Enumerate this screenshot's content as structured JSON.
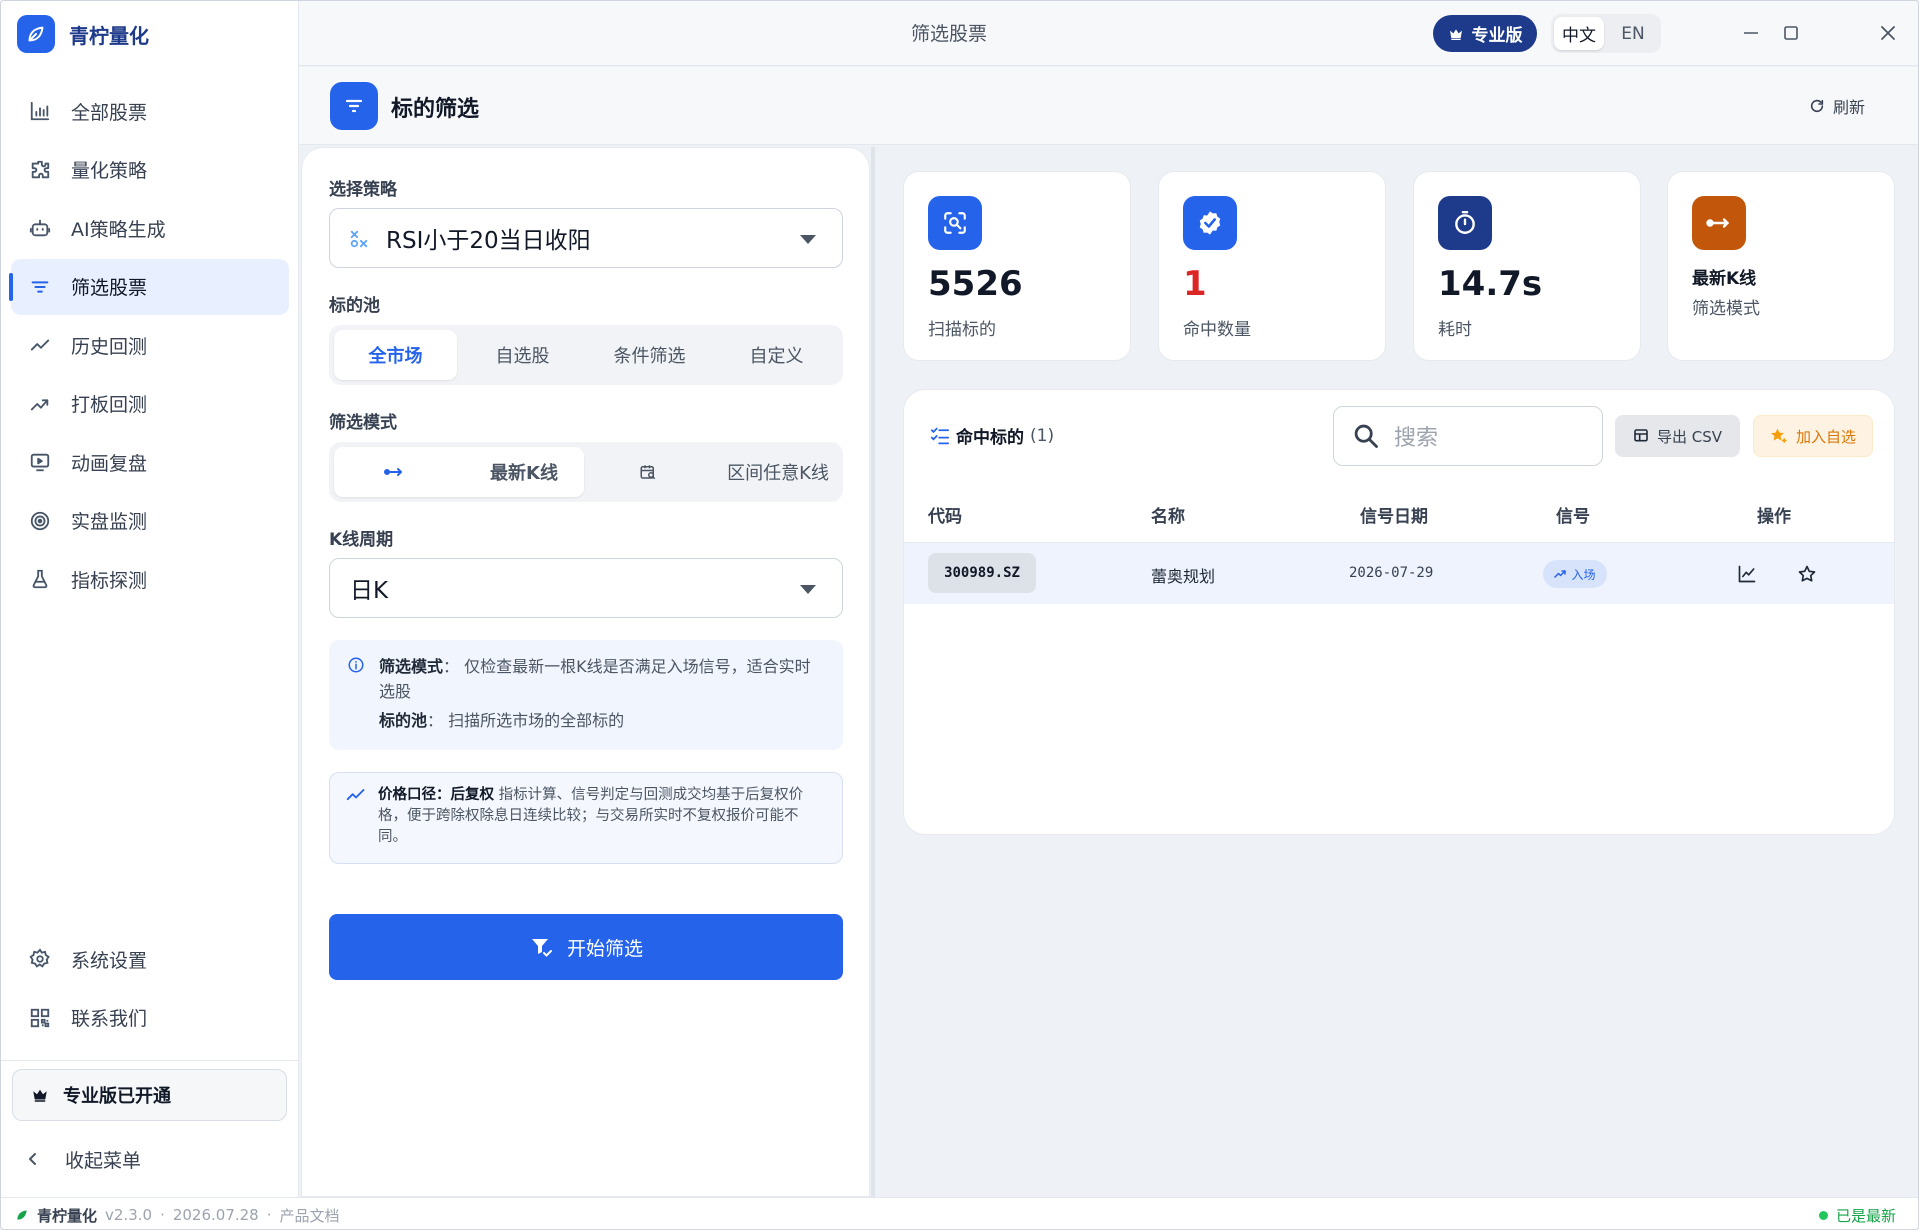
{
  "app": {
    "name": "青柠量化",
    "version": "v2.3.0",
    "build_date": "2026.07.28",
    "docs_link": "产品文档",
    "status": "已是最新"
  },
  "window": {
    "title": "筛选股票"
  },
  "topbar": {
    "pro_label": "专业版",
    "lang_options": [
      "中文",
      "EN"
    ],
    "lang_selected": "中文"
  },
  "sidebar": {
    "items": [
      {
        "label": "全部股票",
        "icon": "bar-chart-icon"
      },
      {
        "label": "量化策略",
        "icon": "puzzle-icon"
      },
      {
        "label": "AI策略生成",
        "icon": "robot-icon"
      },
      {
        "label": "筛选股票",
        "icon": "filter-icon",
        "active": true
      },
      {
        "label": "历史回测",
        "icon": "line-chart-icon"
      },
      {
        "label": "打板回测",
        "icon": "trending-up-icon"
      },
      {
        "label": "动画复盘",
        "icon": "monitor-play-icon"
      },
      {
        "label": "实盘监测",
        "icon": "radar-icon"
      },
      {
        "label": "指标探测",
        "icon": "flask-icon"
      }
    ],
    "bottom": [
      {
        "label": "系统设置",
        "icon": "gear-icon"
      },
      {
        "label": "联系我们",
        "icon": "qr-code-icon"
      }
    ],
    "pro_status": "专业版已开通",
    "collapse_label": "收起菜单"
  },
  "page": {
    "title": "标的筛选",
    "refresh_label": "刷新"
  },
  "form": {
    "strategy_label": "选择策略",
    "strategy_value": "RSI小于20当日收阳",
    "pool_label": "标的池",
    "pool_options": [
      "全市场",
      "自选股",
      "条件筛选",
      "自定义"
    ],
    "pool_selected": "全市场",
    "mode_label": "筛选模式",
    "mode_options": [
      "最新K线",
      "区间任意K线"
    ],
    "mode_selected": "最新K线",
    "period_label": "K线周期",
    "period_value": "日K",
    "info_mode_key": "筛选模式",
    "info_mode_text": "仅检查最新一根K线是否满足入场信号，适合实时选股",
    "info_pool_key": "标的池",
    "info_pool_text": "扫描所选市场的全部标的",
    "price_key": "价格口径：后复权",
    "price_text": "指标计算、信号判定与回测成交均基于后复权价格，便于跨除权除息日连续比较；与交易所实时不复权报价可能不同。",
    "start_button": "开始筛选"
  },
  "stats": [
    {
      "value": "5526",
      "label": "扫描标的",
      "color": "#2563eb",
      "icon": "scan-search-icon"
    },
    {
      "value": "1",
      "label": "命中数量",
      "color": "#2563eb",
      "icon": "verified-badge-icon",
      "value_color": "#dc2626"
    },
    {
      "value": "14.7s",
      "label": "耗时",
      "color": "#1e3a8a",
      "icon": "stopwatch-icon"
    },
    {
      "value": "最新K线",
      "label": "筛选模式",
      "color": "#c2570b",
      "icon": "arrow-range-icon"
    }
  ],
  "results": {
    "title": "命中标的",
    "count": "(1)",
    "search_placeholder": "搜索",
    "export_label": "导出 CSV",
    "add_watch_label": "加入自选",
    "columns": [
      "代码",
      "名称",
      "信号日期",
      "信号",
      "操作"
    ],
    "rows": [
      {
        "code": "300989.SZ",
        "name": "蕾奥规划",
        "date": "2026-07-29",
        "signal": "入场"
      }
    ]
  }
}
